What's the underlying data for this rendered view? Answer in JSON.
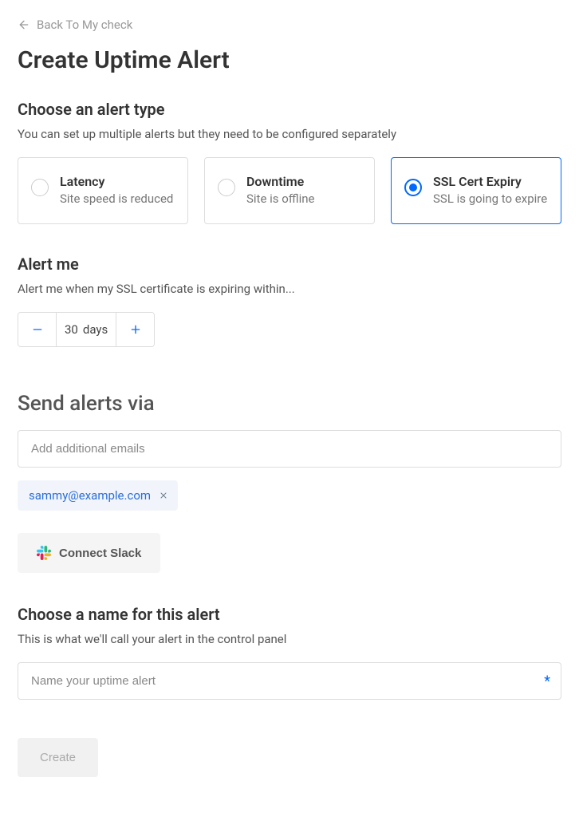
{
  "back_link": "Back To My check",
  "page_title": "Create Uptime Alert",
  "alert_type_section": {
    "title": "Choose an alert type",
    "desc": "You can set up multiple alerts but they need to be configured separately",
    "options": [
      {
        "title": "Latency",
        "desc": "Site speed is reduced",
        "selected": false
      },
      {
        "title": "Downtime",
        "desc": "Site is offline",
        "selected": false
      },
      {
        "title": "SSL Cert Expiry",
        "desc": "SSL is going to expire",
        "selected": true
      }
    ]
  },
  "alert_me_section": {
    "title": "Alert me",
    "desc": "Alert me when my SSL certificate is expiring within...",
    "value": "30",
    "unit": "days"
  },
  "send_alerts_section": {
    "title": "Send alerts via",
    "email_placeholder": "Add additional emails",
    "email_chip": "sammy@example.com",
    "slack_button": "Connect Slack"
  },
  "name_section": {
    "title": "Choose a name for this alert",
    "desc": "This is what we'll call your alert in the control panel",
    "placeholder": "Name your uptime alert"
  },
  "create_button": "Create"
}
